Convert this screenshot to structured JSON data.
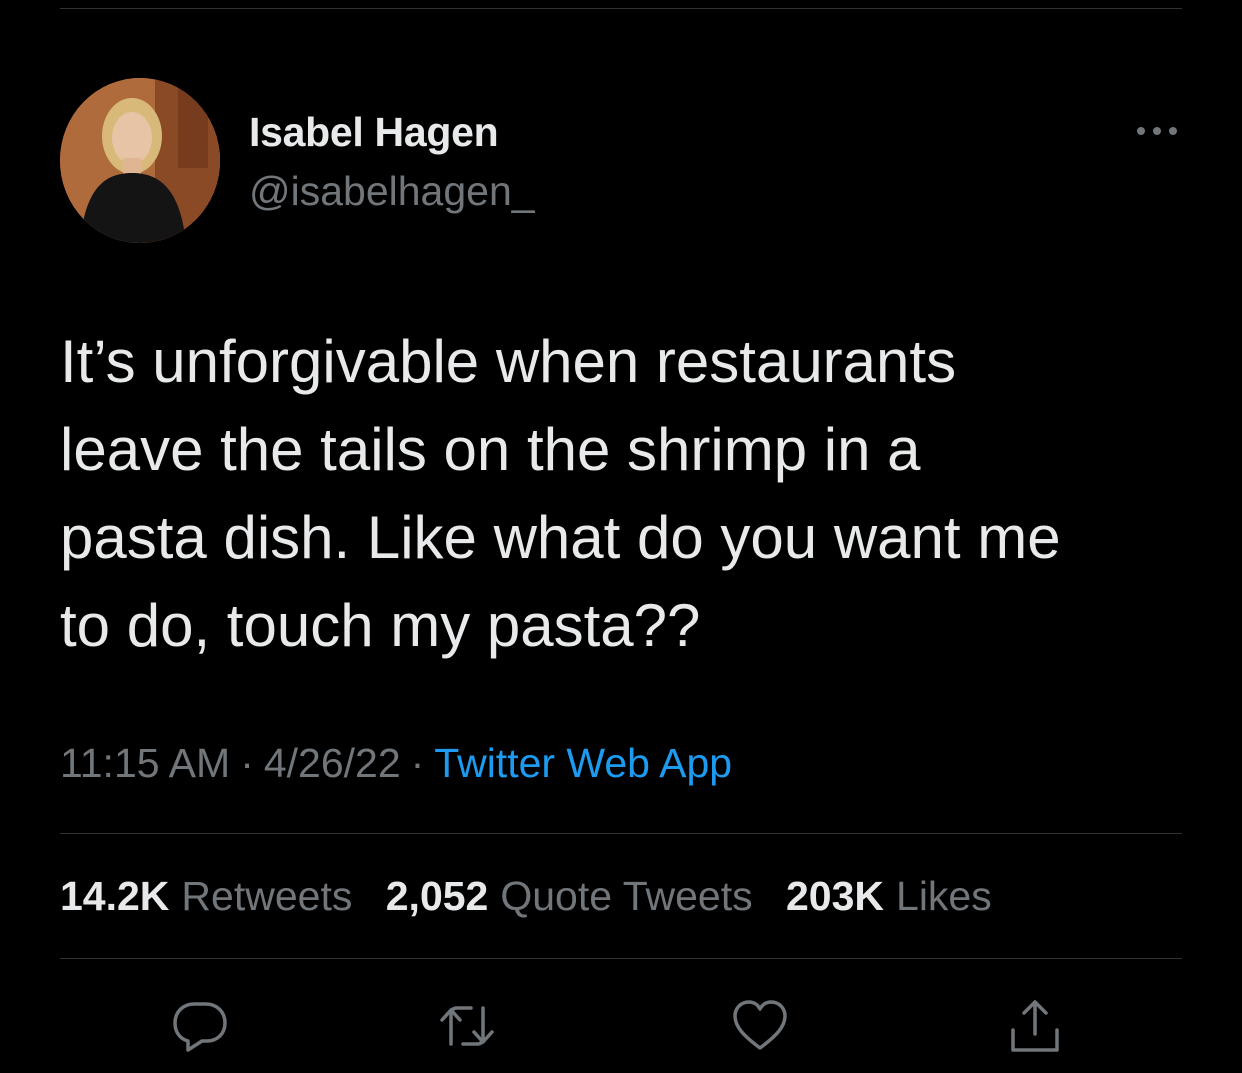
{
  "user": {
    "name": "Isabel Hagen",
    "handle": "@isabelhagen_",
    "avatar_icon": "profile-photo"
  },
  "tweet": {
    "text": "It’s unforgivable when restaurants\nleave the tails on the shrimp in a\npasta dish. Like what do you want me\nto do, touch my pasta??",
    "time": "11:15 AM",
    "date": "4/26/22",
    "separator": "·",
    "source": "Twitter Web App"
  },
  "stats": {
    "retweets_count": "14.2K",
    "retweets_label": "Retweets",
    "quotes_count": "2,052",
    "quotes_label": "Quote Tweets",
    "likes_count": "203K",
    "likes_label": "Likes"
  },
  "actions": {
    "icons": [
      "reply-icon",
      "retweet-icon",
      "like-icon",
      "share-icon"
    ]
  },
  "colors": {
    "background": "#000000",
    "text_primary": "#e7e9ea",
    "text_secondary": "#71767b",
    "link": "#1d9bf0",
    "divider": "#2f3336"
  }
}
